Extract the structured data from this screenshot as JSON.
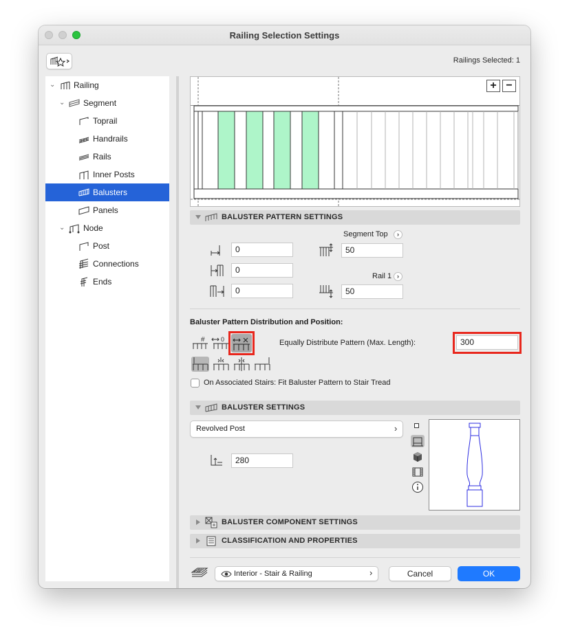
{
  "window": {
    "title": "Railing Selection Settings"
  },
  "header": {
    "selected_count": "Railings Selected: 1"
  },
  "tree": {
    "items": [
      {
        "label": "Railing",
        "icon": "railing-icon"
      },
      {
        "label": "Segment",
        "icon": "segment-icon"
      },
      {
        "label": "Toprail",
        "icon": "toprail-icon"
      },
      {
        "label": "Handrails",
        "icon": "handrails-icon"
      },
      {
        "label": "Rails",
        "icon": "rails-icon"
      },
      {
        "label": "Inner Posts",
        "icon": "inner-posts-icon"
      },
      {
        "label": "Balusters",
        "icon": "balusters-icon",
        "selected": true
      },
      {
        "label": "Panels",
        "icon": "panels-icon"
      },
      {
        "label": "Node",
        "icon": "node-icon"
      },
      {
        "label": "Post",
        "icon": "post-icon"
      },
      {
        "label": "Connections",
        "icon": "connections-icon"
      },
      {
        "label": "Ends",
        "icon": "ends-icon"
      }
    ]
  },
  "preview": {
    "zoom_in": "+",
    "zoom_out": "−",
    "highlight_color": "#aef5c9"
  },
  "pattern_settings": {
    "title": "BALUSTER PATTERN SETTINGS",
    "left_fields": [
      "0",
      "0",
      "0"
    ],
    "segment_top_label": "Segment Top",
    "segment_top_value": "50",
    "rail1_label": "Rail 1",
    "rail1_value": "50"
  },
  "distribution": {
    "title": "Baluster Pattern Distribution and Position:",
    "mode_label": "Equally Distribute Pattern (Max. Length):",
    "mode_value": "300",
    "stairs_checkbox_label": "On Associated Stairs: Fit Baluster Pattern to Stair Tread",
    "stairs_checked": false
  },
  "baluster_settings": {
    "title": "BALUSTER SETTINGS",
    "type": "Revolved Post",
    "height_value": "280"
  },
  "component_settings": {
    "title": "BALUSTER COMPONENT SETTINGS"
  },
  "classification": {
    "title": "CLASSIFICATION AND PROPERTIES"
  },
  "footer": {
    "layer": "Interior - Stair & Railing",
    "cancel": "Cancel",
    "ok": "OK"
  },
  "colors": {
    "accent": "#1f7aff",
    "selection": "#2563d8",
    "callout": "#e8271d"
  }
}
